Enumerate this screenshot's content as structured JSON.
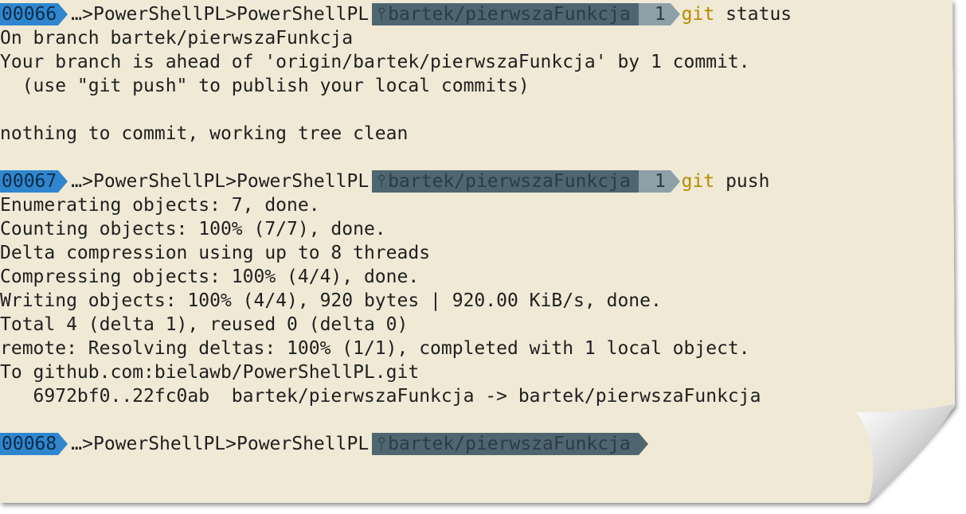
{
  "colors": {
    "paper": "#efe9d6",
    "number_segment": "#2f86cf",
    "git_segment": "#4f6670",
    "ahead_segment": "#8da0a8",
    "command": "#b88a00",
    "text": "#1f1f1f"
  },
  "prompts": [
    {
      "number": "00066",
      "path1": "…",
      "path2": "PowerShellPL",
      "path3": "PowerShellPL",
      "branch_icon": "branch-icon",
      "branch": "bartek/pierwszaFunkcja",
      "ahead": "1",
      "command": "git",
      "args": " status"
    },
    {
      "number": "00067",
      "path1": "…",
      "path2": "PowerShellPL",
      "path3": "PowerShellPL",
      "branch_icon": "branch-icon",
      "branch": "bartek/pierwszaFunkcja",
      "ahead": "1",
      "command": "git",
      "args": " push"
    },
    {
      "number": "00068",
      "path1": "…",
      "path2": "PowerShellPL",
      "path3": "PowerShellPL",
      "branch_icon": "branch-icon",
      "branch": "bartek/pierwszaFunkcja"
    }
  ],
  "separator": ">",
  "status_output": [
    "On branch bartek/pierwszaFunkcja",
    "Your branch is ahead of 'origin/bartek/pierwszaFunkcja' by 1 commit.",
    "  (use \"git push\" to publish your local commits)",
    "",
    "nothing to commit, working tree clean",
    ""
  ],
  "push_output": [
    "Enumerating objects: 7, done.",
    "Counting objects: 100% (7/7), done.",
    "Delta compression using up to 8 threads",
    "Compressing objects: 100% (4/4), done.",
    "Writing objects: 100% (4/4), 920 bytes | 920.00 KiB/s, done.",
    "Total 4 (delta 1), reused 0 (delta 0)",
    "remote: Resolving deltas: 100% (1/1), completed with 1 local object.",
    "To github.com:bielawb/PowerShellPL.git",
    "   6972bf0..22fc0ab  bartek/pierwszaFunkcja -> bartek/pierwszaFunkcja",
    ""
  ]
}
